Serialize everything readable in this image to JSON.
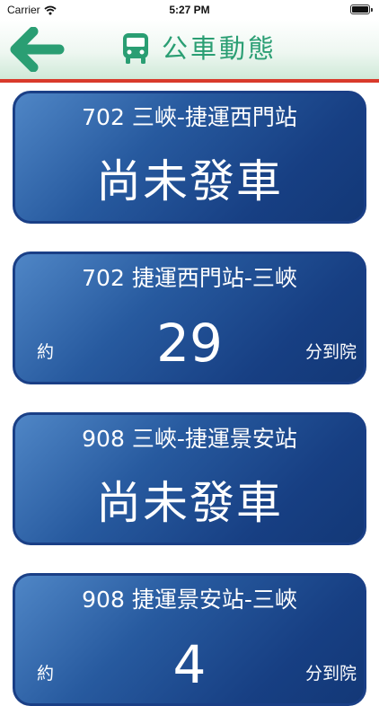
{
  "status_bar": {
    "carrier": "Carrier",
    "time": "5:27 PM"
  },
  "header": {
    "title": "公車動態",
    "back_icon": "arrow-left-icon",
    "title_icon": "bus-icon",
    "colors": {
      "accent": "#2a9e73",
      "divider": "#d93a2b",
      "card": "#1c4a8f"
    }
  },
  "cards": [
    {
      "route": "702 三峽-捷運西門站",
      "status": "尚未發車"
    },
    {
      "route": "702 捷運西門站-三峽",
      "prefix": "約",
      "minutes": "29",
      "suffix": "分到院"
    },
    {
      "route": "908 三峽-捷運景安站",
      "status": "尚未發車"
    },
    {
      "route": "908 捷運景安站-三峽",
      "prefix": "約",
      "minutes": "4",
      "suffix": "分到院"
    }
  ]
}
